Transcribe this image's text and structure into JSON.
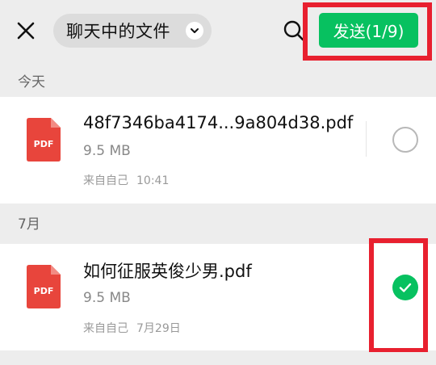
{
  "header": {
    "title": "聊天中的文件",
    "send_label": "发送(1/9)",
    "colors": {
      "accent": "#07c160",
      "highlight": "#e8202f"
    }
  },
  "icons": {
    "close": "close-icon",
    "dropdown": "chevron-down-icon",
    "search": "search-icon",
    "file": "pdf-file-icon",
    "check": "check-icon"
  },
  "sections": [
    {
      "label": "今天",
      "files": [
        {
          "icon_label": "PDF",
          "name": "48f7346ba4174...9a804d38.pdf",
          "size": "9.5 MB",
          "source": "来自自己",
          "time": "10:41",
          "selected": false
        }
      ]
    },
    {
      "label": "7月",
      "files": [
        {
          "icon_label": "PDF",
          "name": "如何征服英俊少男.pdf",
          "size": "9.5 MB",
          "source": "来自自己",
          "time": "7月29日",
          "selected": true
        }
      ]
    }
  ]
}
